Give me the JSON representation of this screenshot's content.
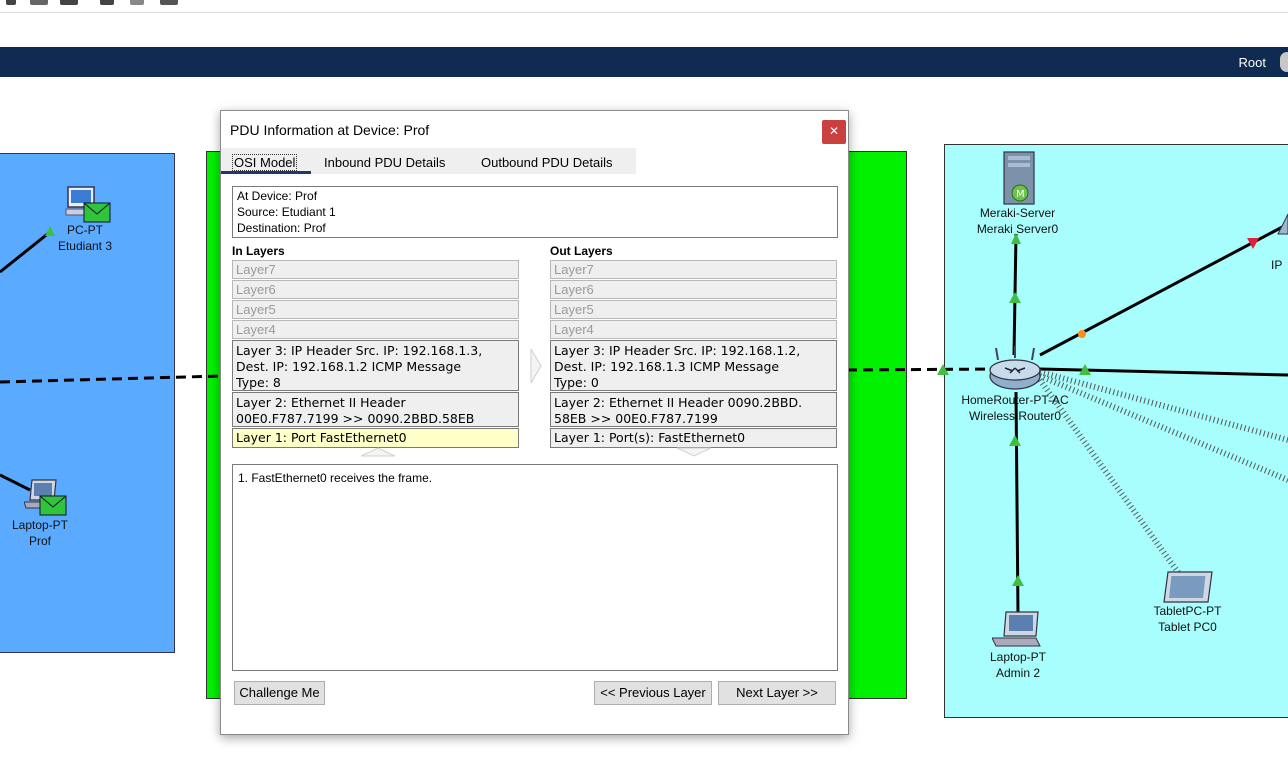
{
  "app": {
    "root_label": "Root"
  },
  "devices": {
    "pc": {
      "type": "PC-PT",
      "name": "Etudiant 3"
    },
    "laptop_prof": {
      "type": "Laptop-PT",
      "name": "Prof"
    },
    "server": {
      "type": "Meraki-Server",
      "name": "Meraki Server0"
    },
    "router": {
      "type": "HomeRouter-PT-AC",
      "name": "Wireless Router0"
    },
    "laptop_admin": {
      "type": "Laptop-PT",
      "name": "Admin 2"
    },
    "tablet": {
      "type": "TabletPC-PT",
      "name": "Tablet PC0"
    },
    "ip_partial": {
      "text": "IP"
    }
  },
  "dialog": {
    "title": "PDU Information at Device: Prof",
    "close_glyph": "✕",
    "tabs": [
      "OSI Model",
      "Inbound PDU Details",
      "Outbound PDU Details"
    ],
    "info": {
      "device": "At Device: Prof",
      "source": "Source: Etudiant 1",
      "destination": "Destination: Prof"
    },
    "in_layers": {
      "heading": "In Layers",
      "layer7": "Layer7",
      "layer6": "Layer6",
      "layer5": "Layer5",
      "layer4": "Layer4",
      "layer3": [
        "Layer 3: IP Header Src. IP: 192.168.1.3,",
        "Dest. IP: 192.168.1.2 ICMP Message",
        "Type: 8"
      ],
      "layer2": [
        "Layer 2: Ethernet II Header",
        "00E0.F787.7199 >> 0090.2BBD.58EB"
      ],
      "layer1": "Layer 1: Port FastEthernet0"
    },
    "out_layers": {
      "heading": "Out Layers",
      "layer7": "Layer7",
      "layer6": "Layer6",
      "layer5": "Layer5",
      "layer4": "Layer4",
      "layer3": [
        "Layer 3: IP Header Src. IP: 192.168.1.2,",
        "Dest. IP: 192.168.1.3 ICMP Message",
        "Type: 0"
      ],
      "layer2": [
        "Layer 2: Ethernet II Header 0090.2BBD.",
        "58EB >> 00E0.F787.7199"
      ],
      "layer1": "Layer 1: Port(s): FastEthernet0"
    },
    "message": "1. FastEthernet0 receives the frame.",
    "buttons": {
      "challenge": "Challenge Me",
      "previous": "<< Previous Layer",
      "next": "Next Layer >>"
    }
  }
}
